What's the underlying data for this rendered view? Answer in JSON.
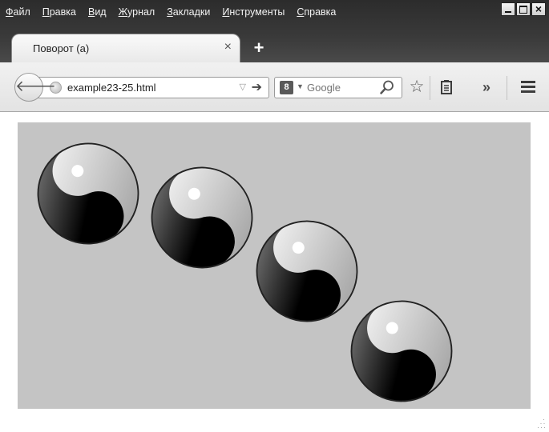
{
  "menu": [
    {
      "u": "Ф",
      "rest": "айл"
    },
    {
      "u": "П",
      "rest": "равка"
    },
    {
      "u": "В",
      "rest": "ид"
    },
    {
      "u": "Ж",
      "rest": "урнал"
    },
    {
      "u": "З",
      "rest": "акладки"
    },
    {
      "u": "И",
      "rest": "нструменты"
    },
    {
      "u": "С",
      "rest": "правка"
    }
  ],
  "tab": {
    "title": "Поворот (a)",
    "close": "×"
  },
  "new_tab": "+",
  "nav": {
    "back_icon": "back-arrow-icon",
    "url": "example23-25.html",
    "search_engine_letter": "8",
    "search_placeholder": "Google"
  },
  "icons": {
    "star": "☆",
    "overflow": "»"
  },
  "window_close": "×",
  "yin_yang_count": 4
}
